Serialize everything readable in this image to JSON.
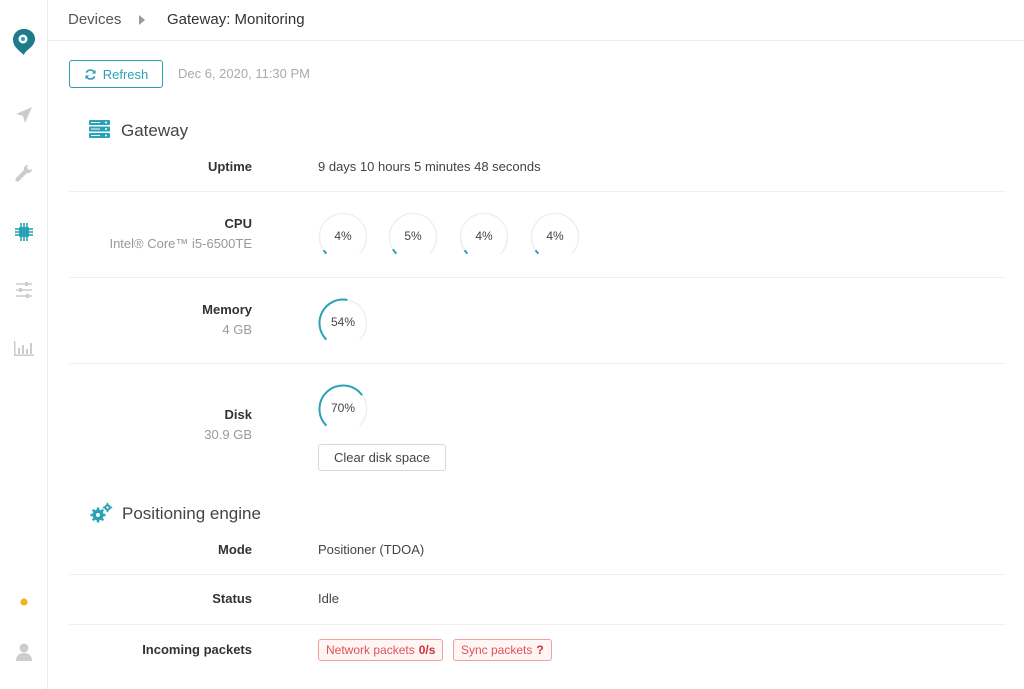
{
  "colors": {
    "accent": "#2aa2b5",
    "status_dot": "#f2b21c",
    "danger": "#e05252"
  },
  "sidebar": {
    "icons": [
      "logo-pin-icon",
      "send-icon",
      "wrench-icon",
      "chip-icon",
      "sliders-icon",
      "bar-chart-icon",
      "status-dot",
      "user-icon"
    ],
    "active": "chip-icon"
  },
  "breadcrumb": {
    "root": "Devices",
    "current": "Gateway: Monitoring"
  },
  "toolbar": {
    "refresh_label": "Refresh",
    "timestamp": "Dec 6, 2020, 11:30 PM"
  },
  "gateway": {
    "title": "Gateway",
    "uptime": {
      "label": "Uptime",
      "value": "9 days 10 hours 5 minutes 48 seconds"
    },
    "cpu": {
      "label": "CPU",
      "model": "Intel® Core™ i5-6500TE",
      "cores": [
        {
          "text": "4%",
          "value": 4
        },
        {
          "text": "5%",
          "value": 5
        },
        {
          "text": "4%",
          "value": 4
        },
        {
          "text": "4%",
          "value": 4
        }
      ]
    },
    "memory": {
      "label": "Memory",
      "size": "4 GB",
      "text": "54%",
      "value": 54
    },
    "disk": {
      "label": "Disk",
      "size": "30.9 GB",
      "text": "70%",
      "value": 70,
      "clear_label": "Clear disk space"
    }
  },
  "positioning": {
    "title": "Positioning engine",
    "mode": {
      "label": "Mode",
      "value": "Positioner (TDOA)"
    },
    "status": {
      "label": "Status",
      "value": "Idle"
    },
    "incoming": {
      "label": "Incoming packets",
      "network": {
        "label": "Network packets",
        "value": "0/s"
      },
      "sync": {
        "label": "Sync packets",
        "value": "?"
      }
    }
  }
}
